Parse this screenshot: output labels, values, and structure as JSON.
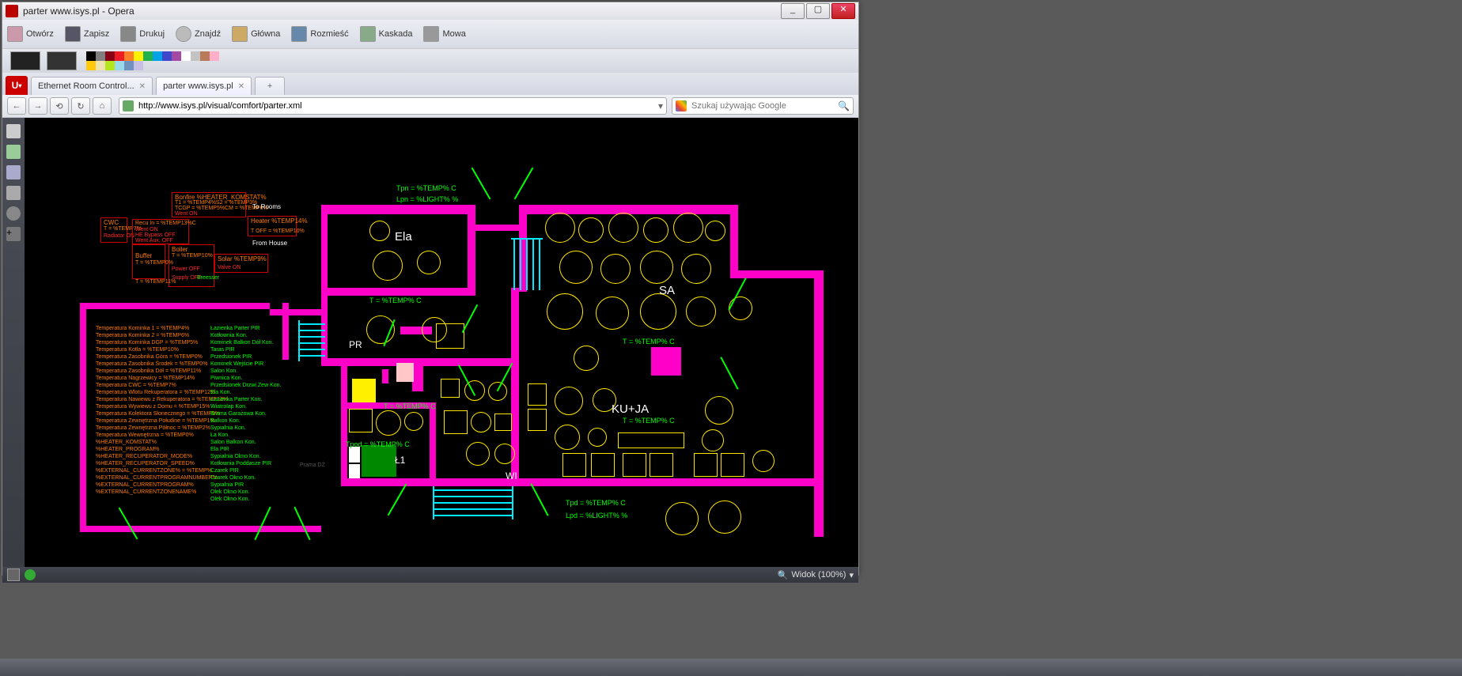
{
  "window": {
    "title": "parter www.isys.pl - Opera"
  },
  "menu": {
    "items": [
      "Otwórz",
      "Zapisz",
      "Drukuj",
      "Znajdź",
      "Główna",
      "Rozmieść",
      "Kaskada",
      "Mowa"
    ]
  },
  "tabs": {
    "items": [
      {
        "label": "Ethernet Room Control..."
      },
      {
        "label": "parter www.isys.pl"
      }
    ],
    "active": 1
  },
  "nav": {
    "url": "http://www.isys.pl/visual/comfort/parter.xml"
  },
  "search": {
    "placeholder": "Szukaj używając Google"
  },
  "status": {
    "zoom": "Widok (100%)"
  },
  "palette": [
    "#000",
    "#7f7f7f",
    "#880015",
    "#ed1c24",
    "#ff7f27",
    "#fff200",
    "#22b14c",
    "#00a2e8",
    "#3f48cc",
    "#a349a4",
    "#fff",
    "#c3c3c3",
    "#b97a57",
    "#ffaec9",
    "#ffc90e",
    "#efe4b0",
    "#b5e61d",
    "#99d9ea",
    "#7092be",
    "#c8bfe7"
  ],
  "plan": {
    "rooms": {
      "ela": "Ela",
      "sa": "SA",
      "pr": "PR",
      "kuja": "KU+JA",
      "l1": "Ł1",
      "wi": "WI"
    },
    "sensors": {
      "tpn": "Tpn = %TEMP% C",
      "lpn": "Lpn = %LIGHT% %",
      "tpd": "Tpd = %TEMP% C",
      "lpd": "Lpd = %LIGHT% %",
      "t_generic": "T = %TEMP% C",
      "tpod": "Tpod = %TEMP% C"
    },
    "hvac": {
      "bonfire": "Bonfire %HEATER_KOMSTAT%",
      "heater": "Heater %TEMP14%",
      "boiler": "Boiler",
      "solar": "Solar %TEMP9%",
      "buffer": "Buffer",
      "cwc": "CWC",
      "toff": "T OFF = %TEMP10%",
      "torooms": "To Rooms",
      "fromhouse": "From House",
      "valveon": "Valve ON",
      "wenton": "Went ON",
      "supplyoff": "Supply OFF",
      "poweroff": "Power OFF",
      "wentauxoff": "Went Aux. OFF",
      "hebypass": "HE Bypass OFF",
      "breesser": "Breesser",
      "recuin": "Recu In = %TEMP13%C",
      "t_temp": "T = %TEMP0%",
      "radiator": "Radiator ON",
      "tt1": "T1 = %TEMP4%S2 = %TEMP3%",
      "tcgp": "TCGP = %TEMP5%CM = %TEMP6%",
      "t_temp11": "T = %TEMP11%",
      "t_temp7": "T = %TEMP7%",
      "t_temp9": "T = %TEMP9%",
      "t_temp10b": "T = %TEMP10%"
    },
    "leftcol": [
      "Temperatura Kominka 1 = %TEMP4%",
      "Temperatura Kominka 2 = %TEMP6%",
      "Temperatura Kominka DGP = %TEMP5%",
      "Temperatura Kotla = %TEMP10%",
      "Temperatura Zasobnika Góra = %TEMP0%",
      "Temperatura Zasobnika Środek = %TEMP0%",
      "Temperatura Zasobnika Dół = %TEMP11%",
      "Temperatura Nagrzewicy = %TEMP14%",
      "Temperatura CWC = %TEMP7%",
      "Temperatura Wlotu Rekuperatora = %TEMP12%",
      "Temperatura Nawiewu z Rekuperatora = %TEMP13%",
      "Temperatura Wywiewu z Domu = %TEMP15%",
      "Temperatura Kolektora Słonecznego = %TEMP9%",
      "Temperatura Zewnętrzna Połudine = %TEMP1%",
      "Temperatura Zewnętrzna Północ = %TEMP2%",
      "Temperatura Wewnętrzna = %TEMP0%",
      "%HEATER_KOMSTAT%",
      "%HEATER_PROGRAM%",
      "%HEATER_RECUPERATOR_MODE%",
      "%HEATER_RECUPERATOR_SPEED%",
      "%EXTERNAL_CURRENTZONE% = %TEMP%",
      "%EXTERNAL_CURRENTPROGRAMNUMBER%",
      "%EXTERNAL_CURRENTPROGRAM%",
      "%EXTERNAL_CURRENTZONENAME%"
    ],
    "rightcol": [
      "Łazienka Parter PIR",
      "Kotłownia Kon.",
      "Kominek Balkon Dół Kon.",
      "Taras PIR",
      "Przedsionek PIR",
      "Kominek Wejście PIR",
      "Salon Kon.",
      "Piwnica Kon.",
      "Przedsionek Drzwi Zew Kon.",
      "Ela Kon.",
      "Łazienka Parter Kon.",
      "Wiatrolap Kon.",
      "Brama Garażowa Kon.",
      "Balkon Kon.",
      "Sypialnia Kon.",
      "Ła Kon.",
      "Salon Balkon Kon.",
      "Ela PIR",
      "Sypialnia Okno Kon.",
      "Kotłownia Poddasze PIR",
      "Czarek PIR",
      "Czarek Okno Kon.",
      "Sypialnia PIR",
      "Olek Okno Kon.",
      "Olek Okno Kon."
    ],
    "pramatext": "Prama DŻ"
  }
}
